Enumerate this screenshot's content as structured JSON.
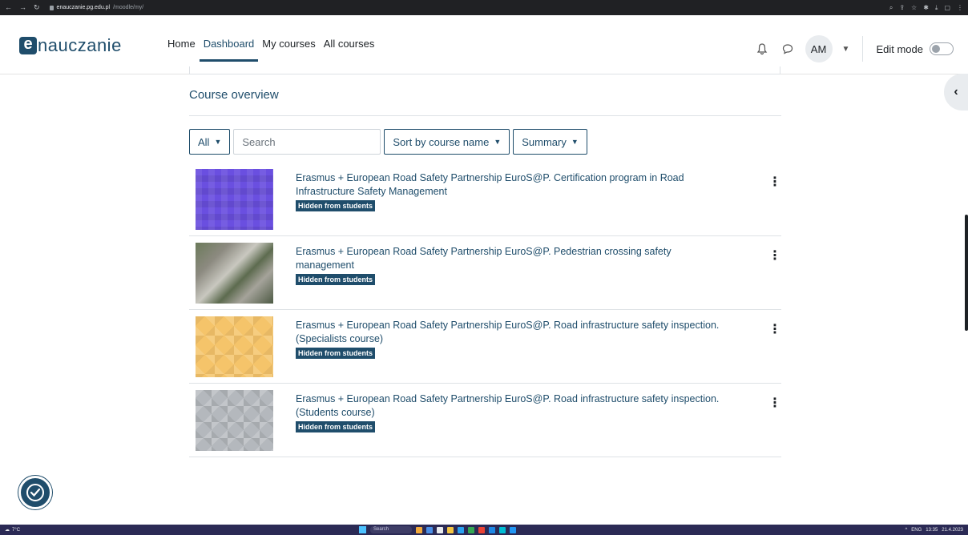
{
  "browser": {
    "url_host": "enauczanie.pg.edu.pl",
    "url_path": "/moodle/my/"
  },
  "logo": {
    "letter": "e",
    "text": "nauczanie"
  },
  "nav": {
    "items": [
      {
        "label": "Home",
        "active": false
      },
      {
        "label": "Dashboard",
        "active": true
      },
      {
        "label": "My courses",
        "active": false
      },
      {
        "label": "All courses",
        "active": false
      }
    ],
    "user_initials": "AM",
    "edit_mode_label": "Edit mode",
    "edit_mode_on": false
  },
  "course_overview": {
    "title": "Course overview",
    "filter_label": "All",
    "search_placeholder": "Search",
    "sort_label": "Sort by course name",
    "view_label": "Summary",
    "courses": [
      {
        "title": "Erasmus + European Road Safety Partnership EuroS@P. Certification program in Road Infrastructure Safety Management",
        "badge": "Hidden from students",
        "thumb": "purple"
      },
      {
        "title": "Erasmus + European Road Safety Partnership EuroS@P. Pedestrian crossing safety management",
        "badge": "Hidden from students",
        "thumb": "street"
      },
      {
        "title": "Erasmus + European Road Safety Partnership EuroS@P. Road infrastructure safety inspection. (Specialists course)",
        "badge": "Hidden from students",
        "thumb": "yellow"
      },
      {
        "title": "Erasmus + European Road Safety Partnership EuroS@P. Road infrastructure safety inspection. (Students course)",
        "badge": "Hidden from students",
        "thumb": "gray"
      }
    ]
  },
  "taskbar": {
    "temperature": "7°C",
    "search_label": "Search",
    "lang": "ENG",
    "time": "13:35",
    "date": "21.4.2023"
  },
  "colors": {
    "brand": "#1f4d6b",
    "chrome": "#202124",
    "taskbar": "#2b2a55"
  }
}
